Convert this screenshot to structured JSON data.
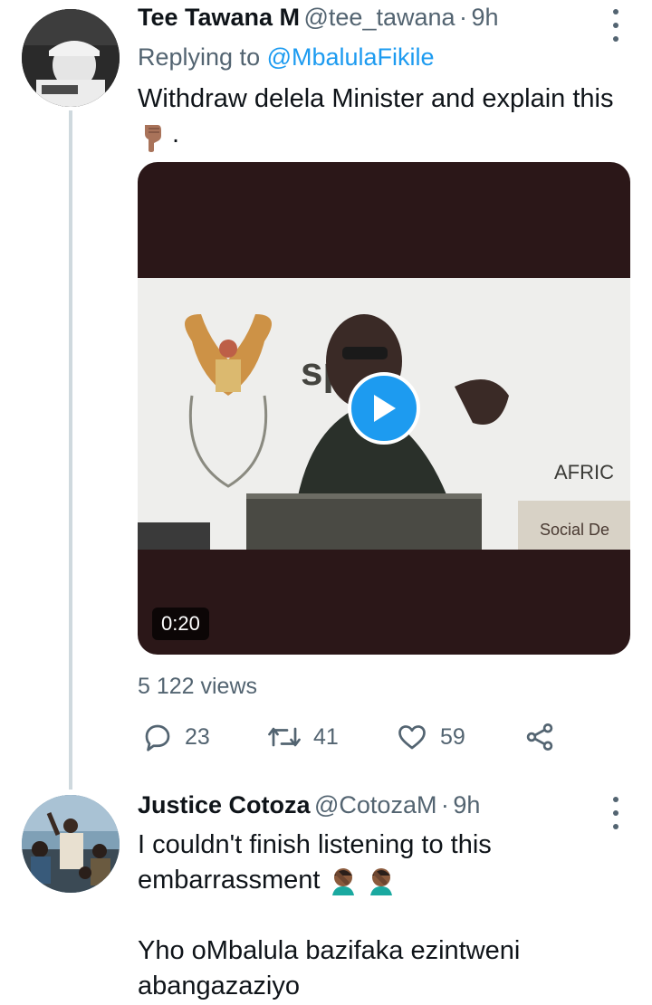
{
  "tweet1": {
    "name": "Tee Tawana M",
    "handle": "@tee_tawana",
    "separator": "·",
    "time": "9h",
    "reply_prefix": "Replying to ",
    "reply_handle": "@MbalulaFikile",
    "text": "Withdraw delela Minister and explain this",
    "text_end": ".",
    "emoji": "pointing-down-hand",
    "video": {
      "duration": "0:20",
      "banner_word": "sport",
      "banner_suffix": "AFRIC",
      "banner_sign": "Social De"
    },
    "views": "5 122 views",
    "actions": {
      "reply_count": "23",
      "retweet_count": "41",
      "like_count": "59"
    }
  },
  "tweet2": {
    "name": "Justice Cotoza",
    "handle": "@CotozaM",
    "separator": "·",
    "time": "9h",
    "line1": "I couldn't finish listening to this",
    "line2": "embarrassment",
    "emoji": "man-facepalming",
    "line3": "Yho oMbalula bazifaka ezintweni",
    "line4": "abangazaziyo"
  },
  "colors": {
    "accent": "#1d9bf0",
    "secondary_text": "#536471",
    "media_bg": "#2b1718"
  }
}
